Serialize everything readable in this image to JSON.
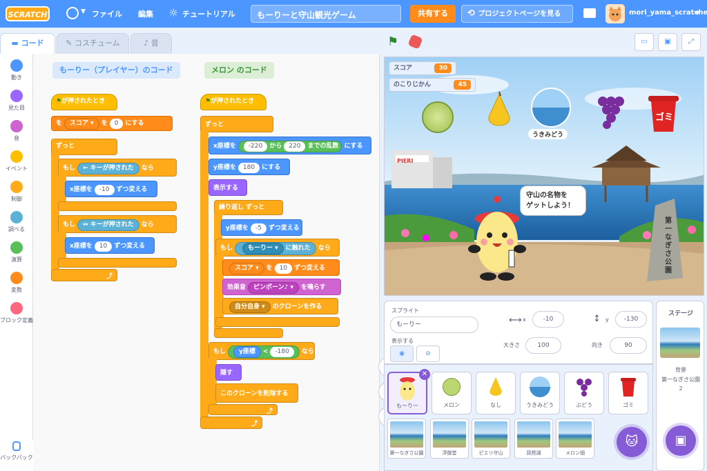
{
  "menu": {
    "logo": "SCRATCH",
    "file": "ファイル",
    "edit": "編集",
    "tutorial": "チュートリアル",
    "project_title": "もーりーと守山観光ゲーム",
    "share": "共有する",
    "project_page": "プロジェクトページを見る",
    "username": "mori_yama_scratcher"
  },
  "tabs": {
    "code": "コード",
    "costume": "コスチューム",
    "sound": "音"
  },
  "categories": [
    {
      "label": "動き",
      "color": "#4c97ff"
    },
    {
      "label": "見た目",
      "color": "#9966ff"
    },
    {
      "label": "音",
      "color": "#cf63cf"
    },
    {
      "label": "イベント",
      "color": "#ffbf00"
    },
    {
      "label": "制御",
      "color": "#ffab19"
    },
    {
      "label": "調べる",
      "color": "#5cb1d6"
    },
    {
      "label": "演算",
      "color": "#59c059"
    },
    {
      "label": "変数",
      "color": "#ff8c1a"
    },
    {
      "label": "ブロック定義",
      "color": "#ff6680"
    }
  ],
  "backpack": "バックパック",
  "script1": {
    "comment": "もーりー（プレイヤー）のコード",
    "hat": "が押されたとき",
    "set_prefix": "を",
    "set_var": "スコア",
    "set_val": "0",
    "set_suffix": "にする",
    "forever": "ずっと",
    "if1": "もし",
    "key1": "←",
    "key_pressed": "キーが押された",
    "then": "なら",
    "changex": "x座標を",
    "dx1": "-10",
    "change_suffix": "ずつ変える",
    "if2": "もし",
    "key2": "↔",
    "dx2": "10"
  },
  "script2": {
    "comment": "メロン のコード",
    "hat": "が押されたとき",
    "forever": "ずっと",
    "setx": "x座標を",
    "rmin": "-220",
    "from": "から",
    "rmax": "220",
    "rand": "までの乱数",
    "set": "にする",
    "sety": "y座標を",
    "yval": "180",
    "show": "表示する",
    "repeat": "繰り返し ずっと",
    "changey": "y座標を",
    "dy": "-5",
    "change": "ずつ変える",
    "if": "もし",
    "touch_target": "もーりー",
    "touching": "に触れた",
    "then": "なら",
    "score_var": "スコア",
    "score_to": "を",
    "score_val": "10",
    "sound_prefix": "効果音",
    "sound": "ピンポーン♪",
    "play": "を鳴らす",
    "clone_target": "自分自身",
    "clone": "のクローンを作る",
    "if2": "もし",
    "ycoord": "y座標",
    "lt": "<",
    "ylim": "-180",
    "hide": "隠す",
    "delete": "このクローンを削除する"
  },
  "zoom": {
    "in": "+",
    "out": "−",
    "reset": "="
  },
  "monitors": [
    {
      "label": "スコア",
      "value": "30"
    },
    {
      "label": "のこりじかん",
      "value": "45"
    }
  ],
  "stage_items": {
    "ukimido": "うきみどう",
    "gomi": "ゴミ",
    "sign": "第一なぎさ公園",
    "bubble": "守山の名物を\nゲットしよう！",
    "hotel": "PIERI"
  },
  "sprite_info": {
    "sprite_label": "スプライト",
    "sprite_name": "もーりー",
    "x_label": "x",
    "x": "-10",
    "y_label": "y",
    "y": "-130",
    "show_label": "表示する",
    "size_label": "大きさ",
    "size": "100",
    "dir_label": "向き",
    "direction": "90"
  },
  "sprites": [
    "もーりー",
    "メロン",
    "なし",
    "うきみどう",
    "ぶどう",
    "ゴミ"
  ],
  "backdrops": [
    "第一なぎさ公園",
    "浮御堂",
    "ピエリ守山",
    "琵琶湖",
    "メロン畑"
  ],
  "stage_panel": {
    "title": "ステージ",
    "bg_label": "背景",
    "bg_name": "第一なぎさ公園",
    "bg_count": "2"
  }
}
